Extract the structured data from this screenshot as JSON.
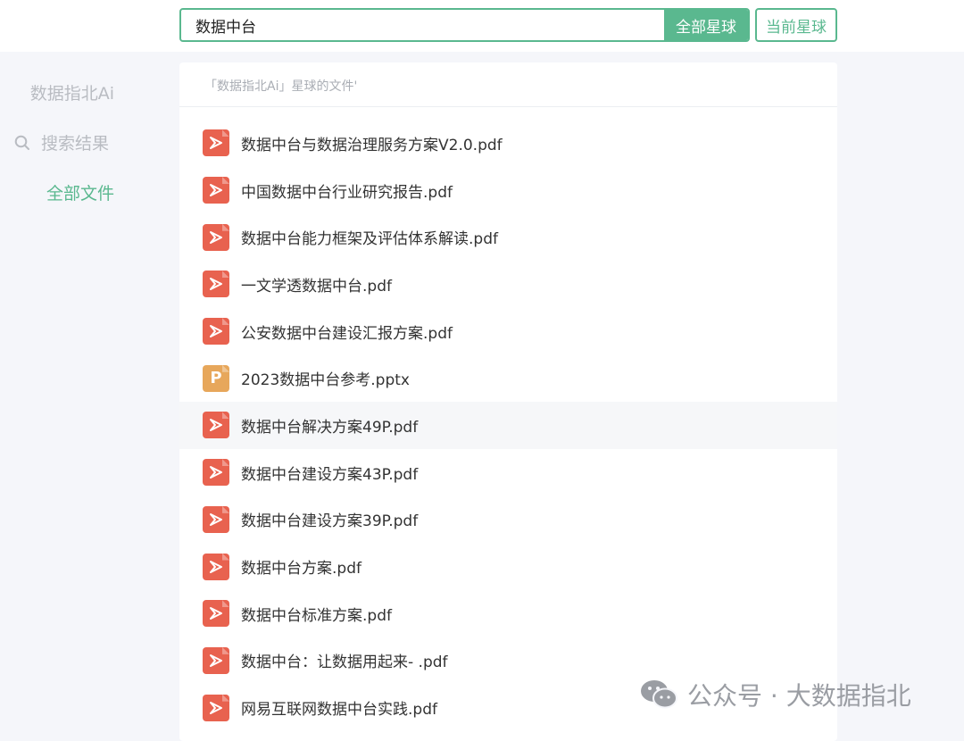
{
  "search": {
    "value": "数据中台",
    "all_planets_label": "全部星球",
    "current_planet_label": "当前星球"
  },
  "sidebar": {
    "title": "数据指北Ai",
    "search_results_label": "搜索结果",
    "all_files_label": "全部文件"
  },
  "panel": {
    "header": "「数据指北Ai」星球的文件'"
  },
  "files": [
    {
      "name": "数据中台与数据治理服务方案V2.0.pdf",
      "type": "pdf"
    },
    {
      "name": "中国数据中台行业研究报告.pdf",
      "type": "pdf"
    },
    {
      "name": "数据中台能力框架及评估体系解读.pdf",
      "type": "pdf"
    },
    {
      "name": "一文学透数据中台.pdf",
      "type": "pdf"
    },
    {
      "name": "公安数据中台建设汇报方案.pdf",
      "type": "pdf"
    },
    {
      "name": "2023数据中台参考.pptx",
      "type": "pptx"
    },
    {
      "name": "数据中台解决方案49P.pdf",
      "type": "pdf"
    },
    {
      "name": "数据中台建设方案43P.pdf",
      "type": "pdf"
    },
    {
      "name": "数据中台建设方案39P.pdf",
      "type": "pdf"
    },
    {
      "name": "数据中台方案.pdf",
      "type": "pdf"
    },
    {
      "name": "数据中台标准方案.pdf",
      "type": "pdf"
    },
    {
      "name": "数据中台：让数据用起来- .pdf",
      "type": "pdf"
    },
    {
      "name": "网易互联网数据中台实践.pdf",
      "type": "pdf"
    }
  ],
  "watermark": "公众号 · 大数据指北",
  "colors": {
    "accent": "#5ab88f",
    "pdf_icon": "#e8624f",
    "pptx_icon": "#e7a75b"
  },
  "icons": {
    "pdf": "pdf-file-icon",
    "pptx": "pptx-file-icon",
    "search": "search-icon",
    "watermark": "wechat-icon"
  }
}
